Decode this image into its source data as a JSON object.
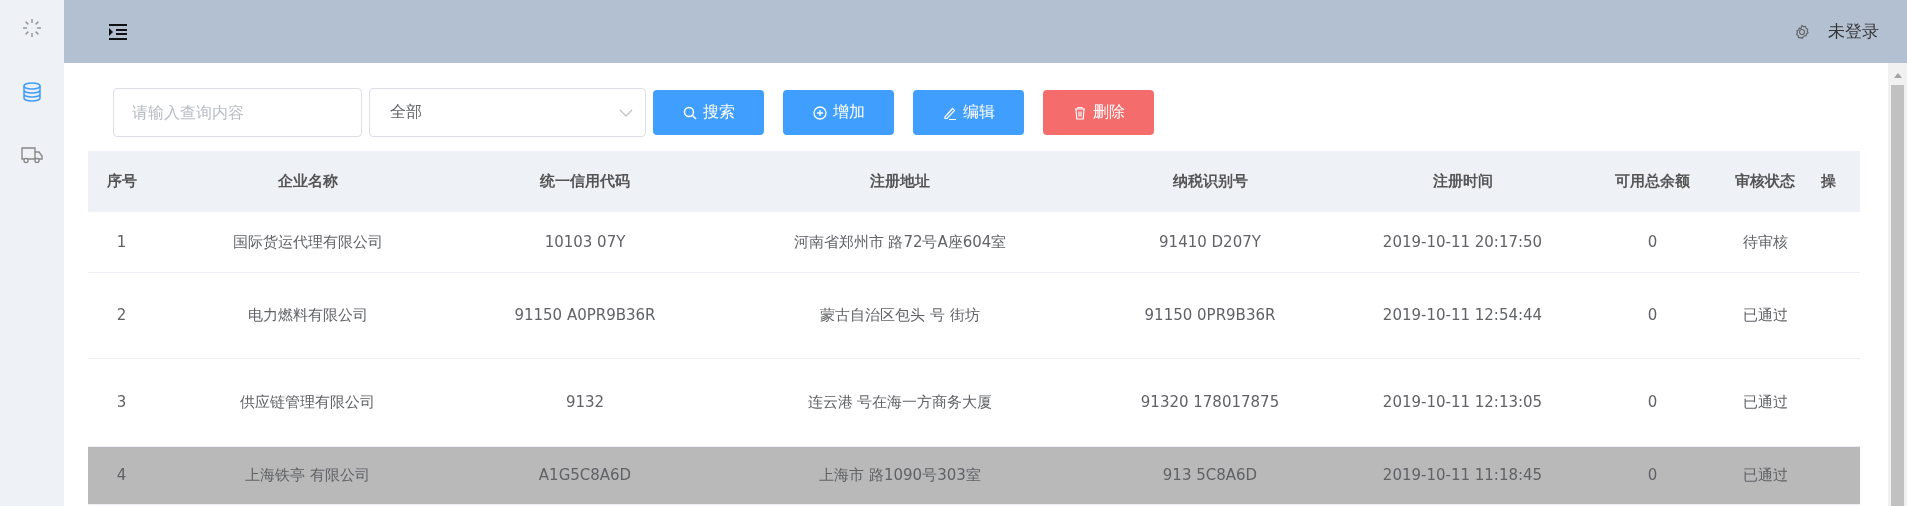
{
  "user": {
    "label": "未登录"
  },
  "toolbar": {
    "search": {
      "placeholder": "请输入查询内容"
    },
    "filter": {
      "value": "全部"
    },
    "buttons": [
      {
        "kind": "search",
        "label": "搜索"
      },
      {
        "kind": "add",
        "label": "增加"
      },
      {
        "kind": "edit",
        "label": "编辑"
      },
      {
        "kind": "delete",
        "label": "删除"
      }
    ]
  },
  "table": {
    "columns": [
      "序号",
      "企业名称",
      "统一信用代码",
      "注册地址",
      "纳税识别号",
      "注册时间",
      "可用总余额",
      "审核状态",
      "操"
    ],
    "rows": [
      {
        "selected": false,
        "cells": [
          "1",
          "国际货运代理有限公司",
          "10103 07Y",
          "河南省郑州市 路72号A座604室",
          "91410 D207Y",
          "2019-10-11 20:17:50",
          "0",
          "待审核"
        ]
      },
      {
        "selected": false,
        "cells": [
          "2",
          "电力燃料有限公司",
          "91150 A0PR9B36R",
          "蒙古自治区包头 号 街坊",
          "91150 0PR9B36R",
          "2019-10-11 12:54:44",
          "0",
          "已通过"
        ]
      },
      {
        "selected": false,
        "cells": [
          "3",
          "供应链管理有限公司",
          "9132",
          "连云港 号在海一方商务大厦",
          "91320 178017875",
          "2019-10-11 12:13:05",
          "0",
          "已通过"
        ]
      },
      {
        "selected": true,
        "cells": [
          "4",
          "上海铁亭 有限公司",
          "A1G5C8A6D",
          "上海市 路1090号303室",
          "913 5C8A6D",
          "2019-10-11 11:18:45",
          "0",
          "已通过"
        ]
      }
    ]
  }
}
